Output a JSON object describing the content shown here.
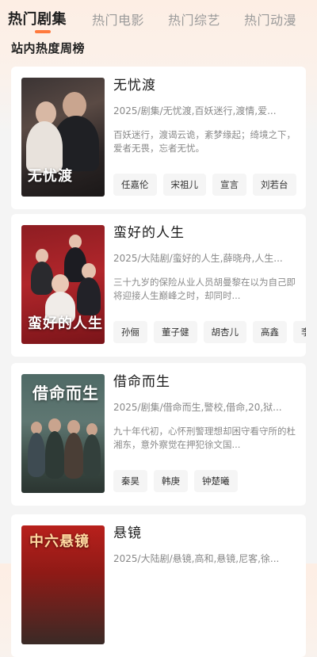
{
  "tabs": [
    {
      "label": "热门剧集",
      "active": true
    },
    {
      "label": "热门电影",
      "active": false
    },
    {
      "label": "热门综艺",
      "active": false
    },
    {
      "label": "热门动漫",
      "active": false
    }
  ],
  "accent_color": "#ff7a3d",
  "section_title": "站内热度周榜",
  "cards": [
    {
      "title": "无忧渡",
      "poster_text": "无忧渡",
      "meta": "2025/剧集/无忧渡,百妖迷行,渡情,爱...",
      "desc": "百妖迷行，渡谒云诡，紊梦缘起；绮境之下，爱者无畏，忘者无忧。",
      "cast": [
        "任嘉伦",
        "宋祖儿",
        "宣言",
        "刘若台"
      ]
    },
    {
      "title": "蛮好的人生",
      "poster_text": "蛮好的人生",
      "meta": "2025/大陆剧/蛮好的人生,薛晓舟,人生...",
      "desc": "三十九岁的保险从业人员胡曼黎在以为自己即将迎接人生巅峰之时，却同时...",
      "cast": [
        "孙俪",
        "董子健",
        "胡杏儿",
        "高鑫",
        "李"
      ]
    },
    {
      "title": "借命而生",
      "poster_text": "借命而生",
      "meta": "2025/剧集/借命而生,警校,借命,20,狱...",
      "desc": "九十年代初，心怀刑警理想却困守看守所的杜湘东，意外察觉在押犯徐文国...",
      "cast": [
        "秦昊",
        "韩庚",
        "钟楚曦"
      ]
    },
    {
      "title": "悬镜",
      "poster_text": "中六悬镜",
      "meta": "2025/大陆剧/悬镜,高和,悬镜,尼客,徐...",
      "desc": "",
      "cast": []
    }
  ]
}
